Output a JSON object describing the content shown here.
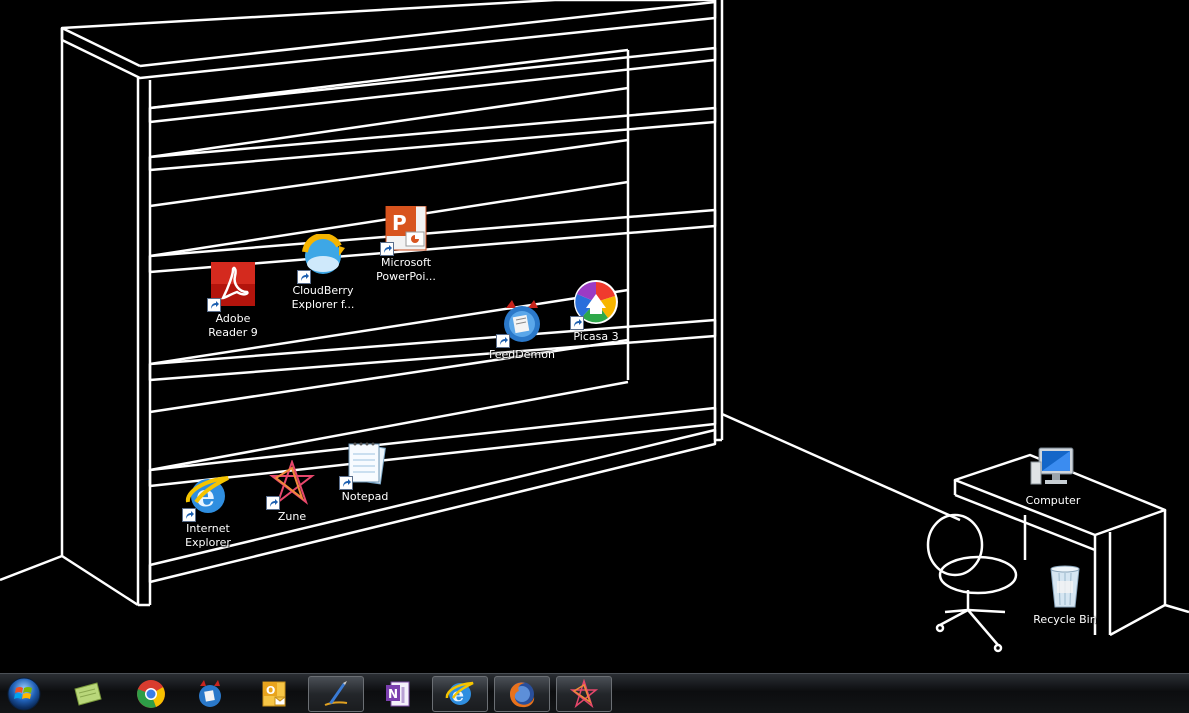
{
  "desktop": {
    "icons": [
      {
        "name": "adobe-reader",
        "label": "Adobe Reader 9",
        "line1": "Adobe",
        "line2": "Reader 9",
        "icon": "adobe-reader-icon"
      },
      {
        "name": "cloudberry",
        "label": "CloudBerry Explorer f...",
        "line1": "CloudBerry",
        "line2": "Explorer f...",
        "icon": "cloudberry-icon"
      },
      {
        "name": "powerpoint",
        "label": "Microsoft PowerPoi...",
        "line1": "Microsoft",
        "line2": "PowerPoi...",
        "icon": "powerpoint-icon"
      },
      {
        "name": "feeddemon",
        "label": "FeedDemon",
        "line1": "FeedDemon",
        "icon": "feeddemon-icon"
      },
      {
        "name": "picasa",
        "label": "Picasa 3",
        "line1": "Picasa 3",
        "icon": "picasa-icon"
      },
      {
        "name": "internet-explorer",
        "label": "Internet Explorer",
        "line1": "Internet",
        "line2": "Explorer",
        "icon": "internet-explorer-icon"
      },
      {
        "name": "zune",
        "label": "Zune",
        "line1": "Zune",
        "icon": "zune-icon"
      },
      {
        "name": "notepad",
        "label": "Notepad",
        "line1": "Notepad",
        "icon": "notepad-icon"
      },
      {
        "name": "computer",
        "label": "Computer",
        "line1": "Computer",
        "icon": "computer-icon"
      },
      {
        "name": "recycle-bin",
        "label": "Recycle Bin",
        "line1": "Recycle Bin",
        "icon": "recycle-bin-icon"
      }
    ]
  },
  "taskbar": {
    "start_icon": "windows-orb-icon",
    "items": [
      {
        "icon": "notes-icon",
        "active": false
      },
      {
        "icon": "chrome-icon",
        "active": false
      },
      {
        "icon": "feeddemon-icon",
        "active": false
      },
      {
        "icon": "outlook-icon",
        "active": false
      },
      {
        "icon": "live-writer-icon",
        "active": true
      },
      {
        "icon": "onenote-icon",
        "active": false
      },
      {
        "icon": "internet-explorer-icon",
        "active": true
      },
      {
        "icon": "firefox-icon",
        "active": true
      },
      {
        "icon": "zune-icon",
        "active": true
      }
    ]
  },
  "colors": {
    "desktop_bg": "#000000",
    "line_art": "#ffffff",
    "taskbar_bg": "#16181b"
  }
}
